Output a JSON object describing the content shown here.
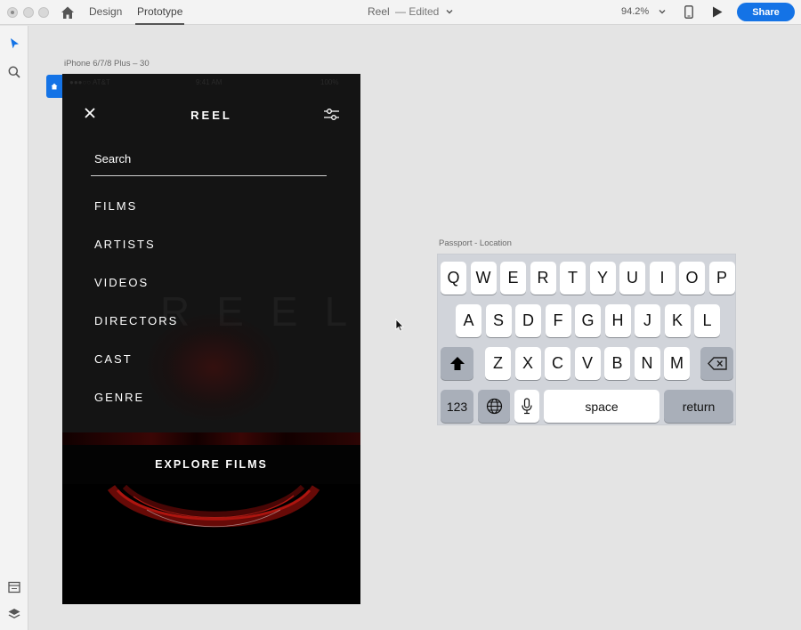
{
  "titlebar": {
    "tabs": [
      "Design",
      "Prototype"
    ],
    "doc_name": "Reel",
    "doc_status": "— Edited",
    "zoom": "94.2%",
    "share_label": "Share",
    "accent_color": "#1473e6"
  },
  "artboards": {
    "phone_label": "iPhone 6/7/8 Plus – 30",
    "keyboard_label": "Passport - Location"
  },
  "phone": {
    "title": "REEL",
    "search_placeholder": "Search",
    "menu": [
      "FILMS",
      "ARTISTS",
      "VIDEOS",
      "DIRECTORS",
      "CAST",
      "GENRE"
    ],
    "cta": "EXPLORE FILMS",
    "background_word": "REEL",
    "status_left": "●●●○○ AT&T",
    "status_time": "9:41 AM",
    "status_right": "100%"
  },
  "keyboard": {
    "row1": [
      "Q",
      "W",
      "E",
      "R",
      "T",
      "Y",
      "U",
      "I",
      "O",
      "P"
    ],
    "row2": [
      "A",
      "S",
      "D",
      "F",
      "G",
      "H",
      "J",
      "K",
      "L"
    ],
    "row3": [
      "Z",
      "X",
      "C",
      "V",
      "B",
      "N",
      "M"
    ],
    "numbers_label": "123",
    "space_label": "space",
    "return_label": "return",
    "icons": [
      "shift-icon",
      "backspace-icon",
      "globe-icon",
      "microphone-icon"
    ]
  },
  "toolbar_icons": [
    "select-tool-icon",
    "search-tool-icon",
    "assets-panel-icon",
    "layers-icon"
  ]
}
